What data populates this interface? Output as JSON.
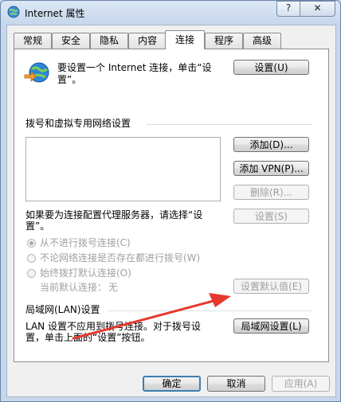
{
  "window": {
    "title": "Internet 属性",
    "help_label": "?",
    "close_label": "✕"
  },
  "tabs": [
    {
      "label": "常规",
      "active": false
    },
    {
      "label": "安全",
      "active": false
    },
    {
      "label": "隐私",
      "active": false
    },
    {
      "label": "内容",
      "active": false
    },
    {
      "label": "连接",
      "active": true
    },
    {
      "label": "程序",
      "active": false
    },
    {
      "label": "高级",
      "active": false
    }
  ],
  "setup": {
    "text_line1": "要设置一个 Internet 连接，单击“设",
    "text_line2": "置”。",
    "button": "设置(U)"
  },
  "dialup": {
    "group_title": "拨号和虚拟专用网络设置",
    "add_button": "添加(D)...",
    "add_vpn_button": "添加 VPN(P)...",
    "remove_button": "删除(R)...",
    "proxy_text_line1": "如果要为连接配置代理服务器，请选择“设",
    "proxy_text_line2": "置”。",
    "settings_button": "设置(S)",
    "radio_options": [
      {
        "label": "从不进行拨号连接(C)",
        "selected": true
      },
      {
        "label": "不论网络连接是否存在都进行拨号(W)",
        "selected": false
      },
      {
        "label": "始终拨打默认连接(O)",
        "selected": false
      }
    ],
    "default_label": "当前默认连接：",
    "default_value": "无",
    "set_default_button": "设置默认值(E)"
  },
  "lan": {
    "group_title": "局域网(LAN)设置",
    "text_line1": "LAN 设置不应用到拨号连接。对于拨号设",
    "text_line2": "置，单击上面的“设置”按钮。",
    "button": "局域网设置(L)"
  },
  "footer": {
    "ok": "确定",
    "cancel": "取消",
    "apply": "应用(A)"
  },
  "colors": {
    "annotation_arrow": "#e8392f",
    "accent": "#3c7fb1"
  }
}
